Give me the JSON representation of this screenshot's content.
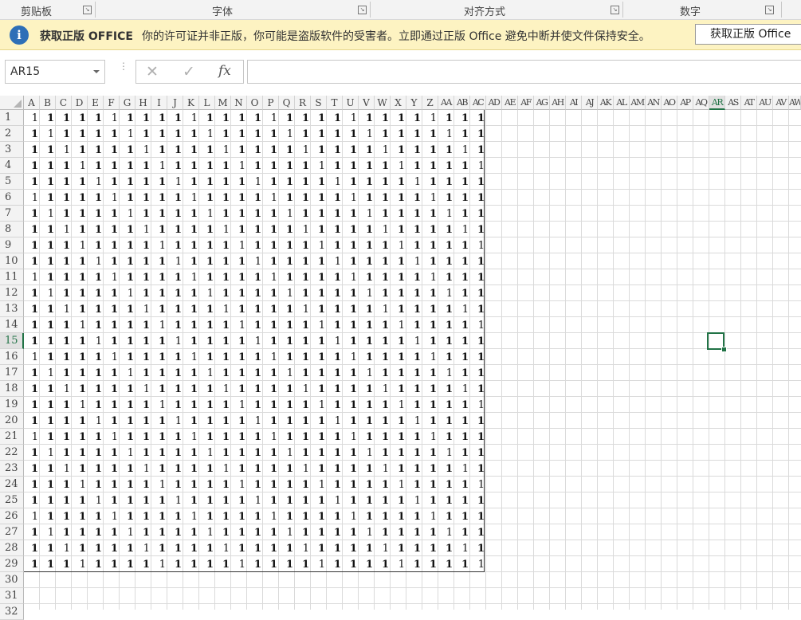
{
  "ribbon_groups": [
    {
      "label": "剪贴板",
      "launcher": true
    },
    {
      "label": "字体",
      "launcher": true
    },
    {
      "label": "对齐方式",
      "launcher": true
    },
    {
      "label": "数字",
      "launcher": true
    }
  ],
  "license_bar": {
    "icon": "info-icon",
    "title": "获取正版 OFFICE",
    "message": "你的许可证并非正版，你可能是盗版软件的受害者。立即通过正版 Office 避免中断并使文件保持安全。",
    "button_label": "获取正版 Office"
  },
  "formula_bar": {
    "name_box": "AR15",
    "formula": ""
  },
  "columns": [
    "A",
    "B",
    "C",
    "D",
    "E",
    "F",
    "G",
    "H",
    "I",
    "J",
    "K",
    "L",
    "M",
    "N",
    "O",
    "P",
    "Q",
    "R",
    "S",
    "T",
    "U",
    "V",
    "W",
    "X",
    "Y",
    "Z",
    "AA",
    "AB",
    "AC",
    "AD",
    "AE",
    "AF",
    "AG",
    "AH",
    "AI",
    "AJ",
    "AK",
    "AL",
    "AM",
    "AN",
    "AO",
    "AP",
    "AQ",
    "AR",
    "AS",
    "AT",
    "AU",
    "AV",
    "AW"
  ],
  "rows": [
    "1",
    "2",
    "3",
    "4",
    "5",
    "6",
    "7",
    "8",
    "9",
    "10",
    "11",
    "12",
    "13",
    "14",
    "15",
    "16",
    "17",
    "18",
    "19",
    "20",
    "21",
    "22",
    "23",
    "24",
    "25",
    "26",
    "27",
    "28",
    "29",
    "30",
    "31",
    "32"
  ],
  "selected_column": "AR",
  "selected_row": "15",
  "cell_value": "1",
  "data_rows": 29,
  "data_cols": 29,
  "colors": {
    "accent": "#217346",
    "license_bg": "#fdf3c2",
    "info_icon": "#2e6fb7"
  }
}
